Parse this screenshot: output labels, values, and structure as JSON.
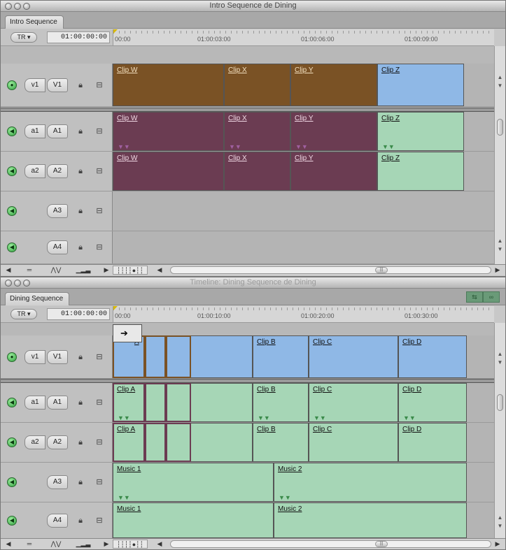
{
  "win1": {
    "title": "Intro Sequence de Dining",
    "tab": "Intro Sequence",
    "tr": "TR",
    "timecode": "01:00:00:00",
    "ruler": [
      "00:00",
      "01:00:03:00",
      "01:00:06:00",
      "01:00:09:00"
    ],
    "v1": {
      "src": "v1",
      "dst": "V1",
      "clips": [
        "Clip W",
        "Clip X",
        "Clip Y",
        "Clip Z"
      ]
    },
    "a1": {
      "src": "a1",
      "dst": "A1",
      "clips": [
        "Clip W",
        "Clip X",
        "Clip Y",
        "Clip Z"
      ]
    },
    "a2": {
      "src": "a2",
      "dst": "A2",
      "clips": [
        "Clip W",
        "Clip X",
        "Clip Y",
        "Clip Z"
      ]
    },
    "a3": {
      "dst": "A3"
    },
    "a4": {
      "dst": "A4"
    }
  },
  "win2": {
    "title": "Timeline: Dining Sequence de Dining",
    "tab": "Dining Sequence",
    "tr": "TR",
    "timecode": "01:00:00:00",
    "ruler": [
      "00:00",
      "01:00:10:00",
      "01:00:20:00",
      "01:00:30:00"
    ],
    "v1": {
      "src": "v1",
      "dst": "V1",
      "clips": [
        "A",
        "Clip B",
        "Clip C",
        "Clip D"
      ]
    },
    "a1": {
      "src": "a1",
      "dst": "A1",
      "clips": [
        "Clip A",
        "Clip B",
        "Clip C",
        "Clip D"
      ]
    },
    "a2": {
      "src": "a2",
      "dst": "A2",
      "clips": [
        "Clip A",
        "Clip B",
        "Clip C",
        "Clip D"
      ]
    },
    "a3": {
      "dst": "A3",
      "clips": [
        "Music 1",
        "Music 2"
      ]
    },
    "a4": {
      "dst": "A4",
      "clips": [
        "Music 1",
        "Music 2"
      ]
    }
  },
  "icons": {
    "speaker": "speaker-icon",
    "lock": "lock-icon",
    "link": "link-icon",
    "drag_arrow": "arrow-right-icon"
  },
  "colors": {
    "brown_clip": "#7a5225",
    "blue_clip": "#8fb8e6",
    "purple_clip": "#6b3c52",
    "green_clip": "#a6d6b6"
  }
}
